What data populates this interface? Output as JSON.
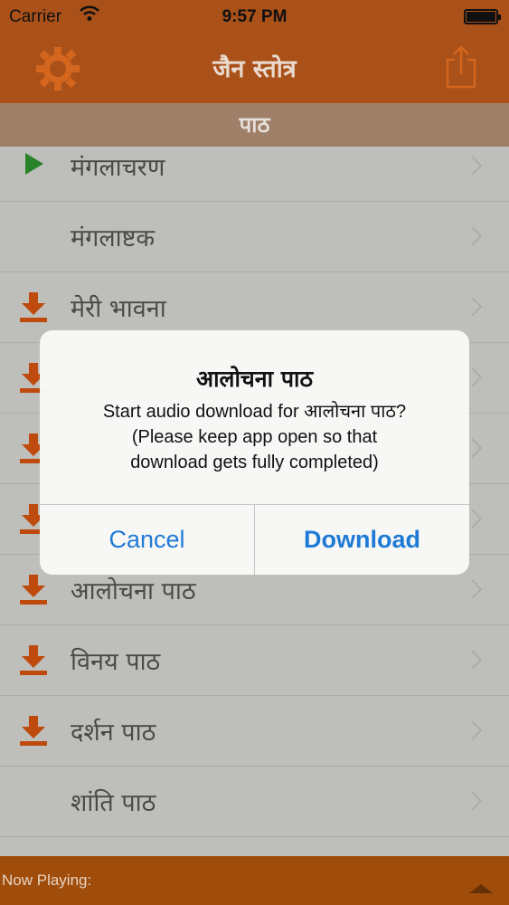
{
  "status": {
    "carrier": "Carrier",
    "time": "9:57 PM"
  },
  "nav": {
    "title": "जैन स्तोत्र"
  },
  "section": {
    "header": "पाठ"
  },
  "list": {
    "items": [
      {
        "label": "मंगलाचरण",
        "icon": "play"
      },
      {
        "label": "मंगलाष्टक",
        "icon": "none"
      },
      {
        "label": "मेरी भावना",
        "icon": "download"
      },
      {
        "label": "",
        "icon": "download"
      },
      {
        "label": "",
        "icon": "download"
      },
      {
        "label": "",
        "icon": "download"
      },
      {
        "label": "आलोचना पाठ",
        "icon": "download"
      },
      {
        "label": "विनय पाठ",
        "icon": "download"
      },
      {
        "label": "दर्शन पाठ",
        "icon": "download"
      },
      {
        "label": "शांति पाठ",
        "icon": "none"
      }
    ]
  },
  "now_playing": {
    "label": "Now Playing:"
  },
  "alert": {
    "title": "आलोचना पाठ",
    "message": "Start audio download for आलोचना पाठ?\n(Please keep app open so that\ndownload gets fully completed)",
    "cancel": "Cancel",
    "download": "Download"
  },
  "colors": {
    "accent": "#b4561c",
    "section": "#a9866f",
    "link": "#1f7ad6",
    "icon": "#c94f0e",
    "play": "#2d8a2d"
  }
}
